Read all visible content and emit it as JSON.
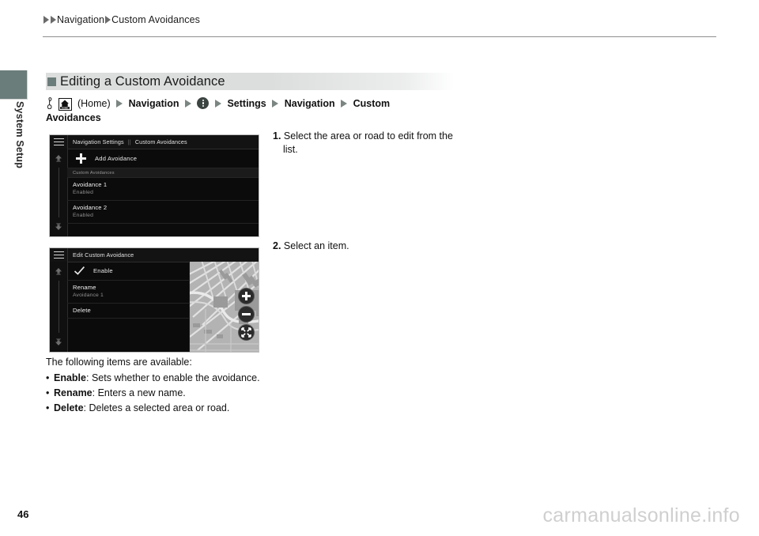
{
  "breadcrumb": {
    "item1": "Navigation",
    "item2": "Custom Avoidances"
  },
  "sidebar": {
    "label": "System Setup"
  },
  "section": {
    "title": "Editing a Custom Avoidance"
  },
  "path": {
    "home_label": "(Home)",
    "seg1": "Navigation",
    "seg2": "Settings",
    "seg3": "Navigation",
    "seg4": "Custom",
    "seg5": "Avoidances",
    "home_icon_text": "HOME"
  },
  "device1": {
    "crumb_primary": "Navigation Settings",
    "crumb_separator": "||",
    "crumb_secondary": "Custom Avoidances",
    "add_label": "Add Avoidance",
    "group_label": "Custom Avoidances",
    "items": [
      {
        "title": "Avoidance 1",
        "sub": "Enabled"
      },
      {
        "title": "Avoidance 2",
        "sub": "Enabled"
      }
    ]
  },
  "device2": {
    "title": "Edit Custom Avoidance",
    "enable_label": "Enable",
    "rename_label": "Rename",
    "rename_value": "Avoidance 1",
    "delete_label": "Delete",
    "map_buttons": {
      "zoom_in": "+",
      "zoom_out": "-",
      "expand": "expand"
    }
  },
  "steps": {
    "step1_num": "1.",
    "step1_text": "Select the area or road to edit from the list.",
    "step2_num": "2.",
    "step2_text": "Select an item."
  },
  "items": {
    "intro": "The following items are available:",
    "list": [
      {
        "term": "Enable",
        "desc": ": Sets whether to enable the avoidance."
      },
      {
        "term": "Rename",
        "desc": ": Enters a new name."
      },
      {
        "term": "Delete",
        "desc": ": Deletes a selected area or road."
      }
    ]
  },
  "footer": {
    "page_number": "46",
    "watermark": "carmanualsonline.info"
  },
  "colors": {
    "tab": "#6b7d7a",
    "band": "#dcdedd",
    "device_bg": "#0b0b0b"
  }
}
